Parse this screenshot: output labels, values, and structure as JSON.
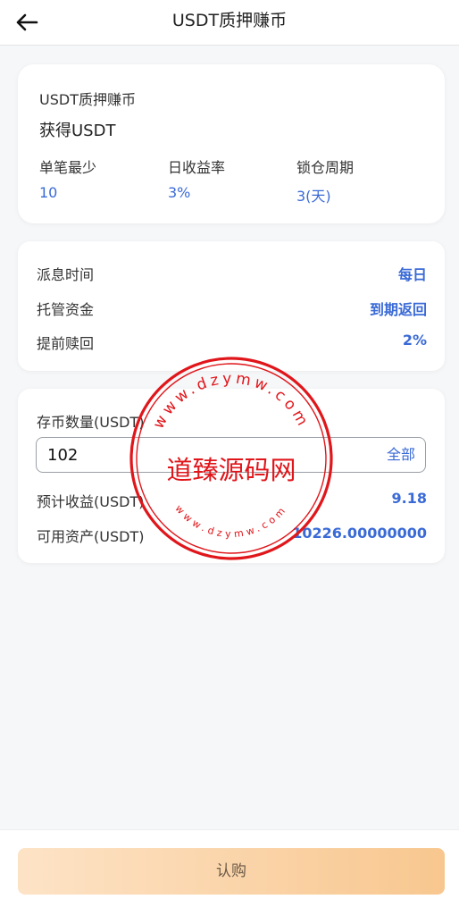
{
  "header": {
    "title": "USDT质押赚币"
  },
  "product": {
    "title": "USDT质押赚币",
    "subtitle": "获得USDT",
    "stats": [
      {
        "label": "单笔最少",
        "value": "10"
      },
      {
        "label": "日收益率",
        "value": "3%"
      },
      {
        "label": "锁仓周期",
        "value": "3(天)"
      }
    ]
  },
  "terms": [
    {
      "label": "派息时间",
      "value": "每日"
    },
    {
      "label": "托管资金",
      "value": "到期返回"
    },
    {
      "label": "提前赎回",
      "value": "2%"
    }
  ],
  "deposit": {
    "label": "存币数量(USDT)",
    "amount": "102",
    "all_label": "全部",
    "estimate_label": "预计收益(USDT)",
    "estimate_value": "9.18",
    "available_label": "可用资产(USDT)",
    "available_value": "10226.00000000"
  },
  "footer": {
    "buy_label": "认购"
  },
  "watermark": {
    "center_text": "道臻源码网",
    "ring_text": "www.dzymw.com"
  },
  "colors": {
    "accent": "#3a6ad6",
    "button_gradient_start": "#fde3c6",
    "button_gradient_end": "#f8c78f",
    "stamp_red": "#e0161b"
  }
}
